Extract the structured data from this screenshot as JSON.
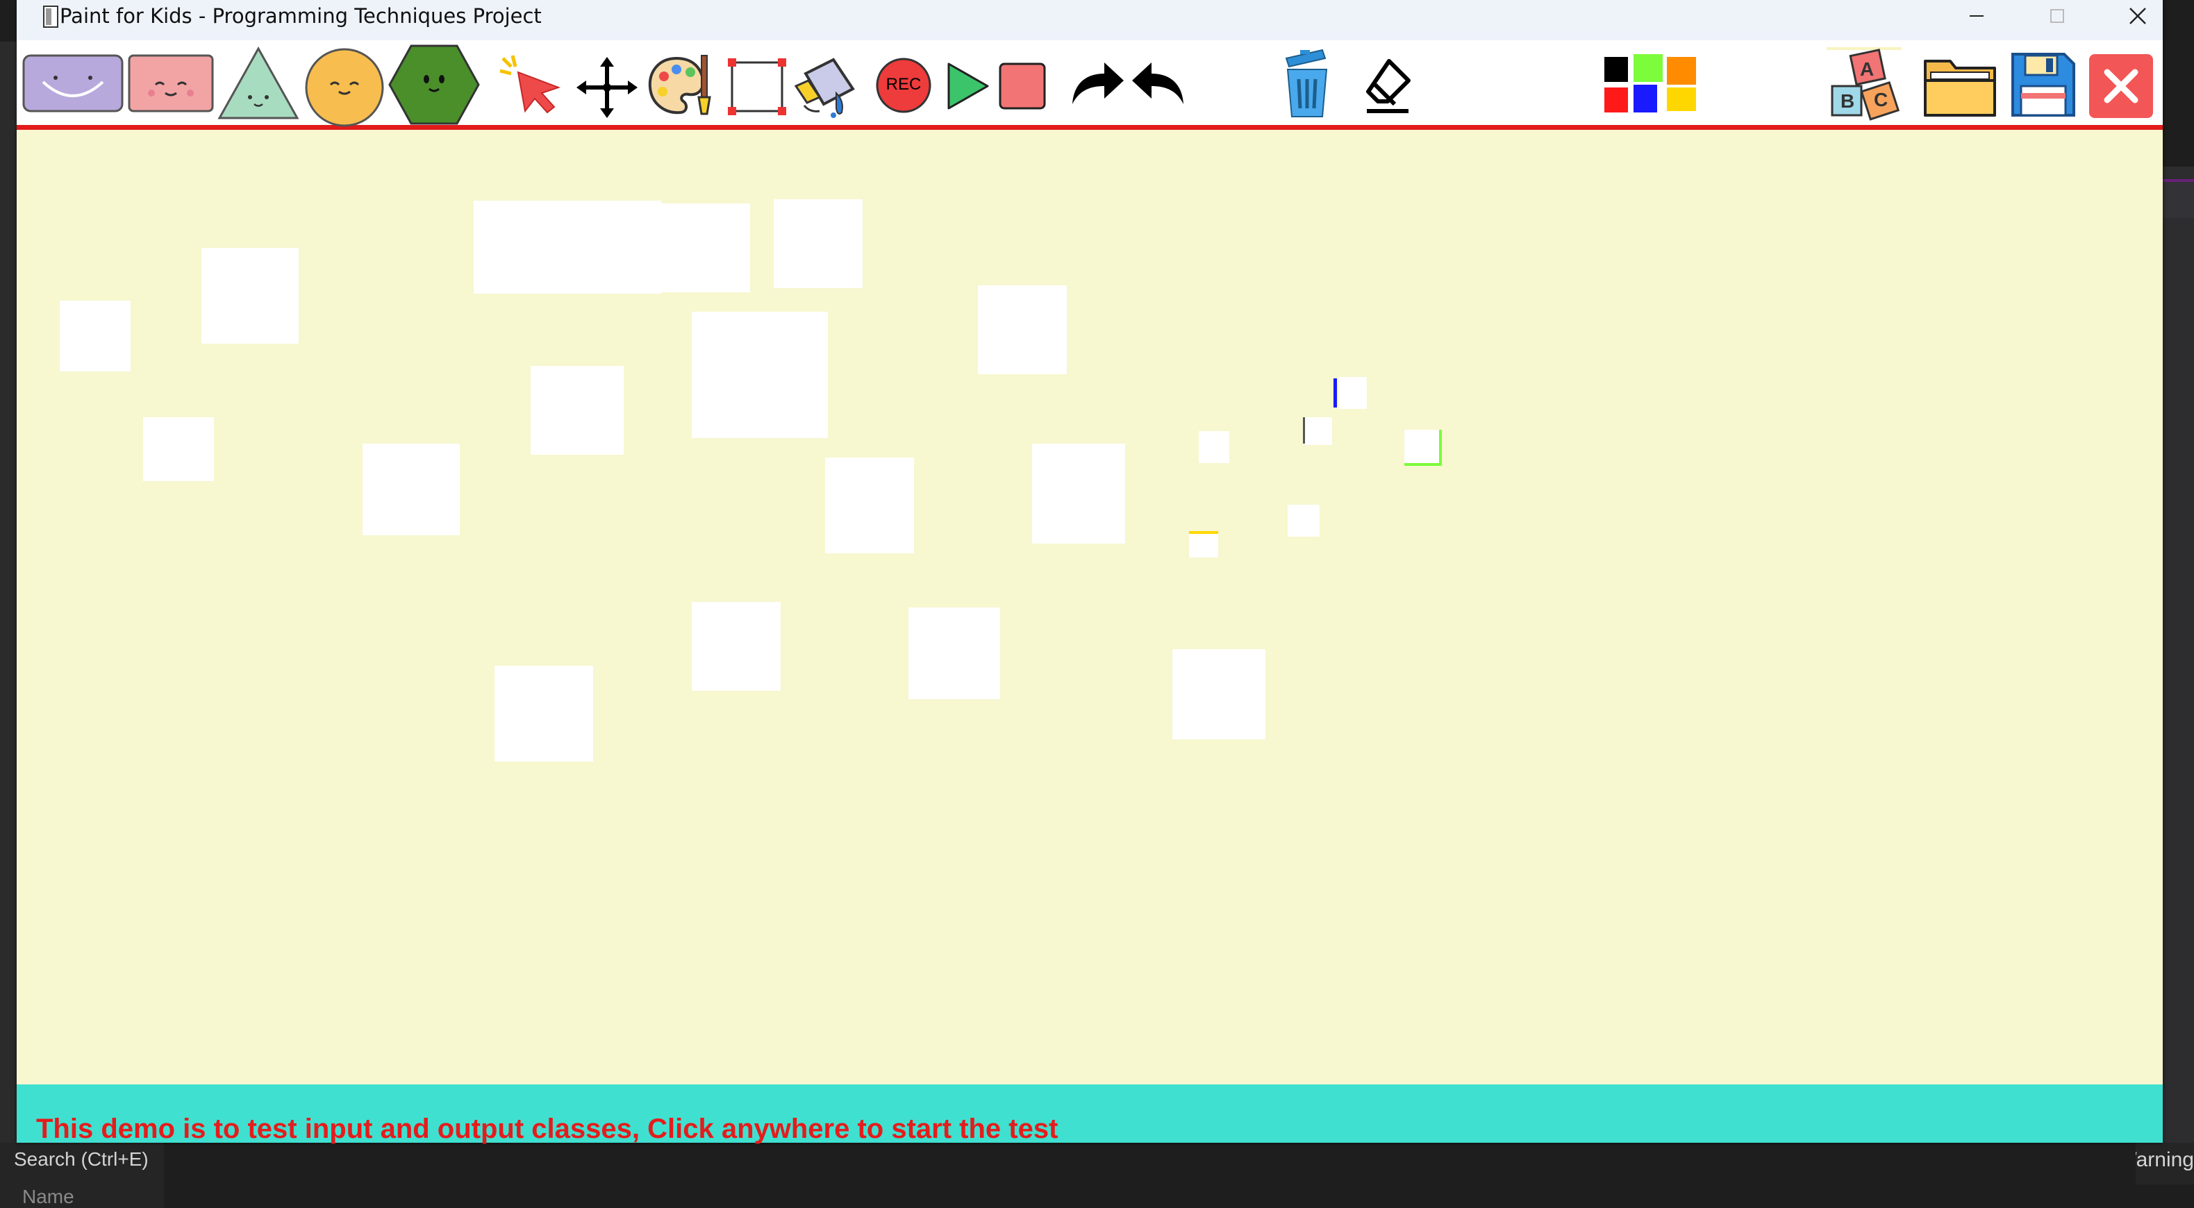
{
  "window": {
    "title": "Paint for Kids - Programming Techniques Project",
    "title_icon": "app-window-icon",
    "controls": [
      "minimize-icon",
      "maximize-icon",
      "close-icon"
    ]
  },
  "toolbar": {
    "shape_tools": [
      {
        "name": "oval-shape-tool",
        "icon": "purple-smiling-oval"
      },
      {
        "name": "rectangle-shape-tool",
        "icon": "pink-smiling-rectangle"
      },
      {
        "name": "triangle-shape-tool",
        "icon": "green-smiling-triangle"
      },
      {
        "name": "circle-shape-tool",
        "icon": "orange-smiling-circle"
      },
      {
        "name": "hexagon-shape-tool",
        "icon": "green-smiling-hexagon"
      }
    ],
    "action_tools": [
      {
        "name": "select-tool",
        "icon": "pointer-icon"
      },
      {
        "name": "move-tool",
        "icon": "move-arrows-icon"
      },
      {
        "name": "color-palette-tool",
        "icon": "palette-icon"
      },
      {
        "name": "resize-tool",
        "icon": "resize-frame-icon"
      },
      {
        "name": "fill-tool",
        "icon": "paint-bucket-icon"
      }
    ],
    "record_label": "REC",
    "record_tools": [
      {
        "name": "record-button",
        "icon": "rec-icon"
      },
      {
        "name": "play-button",
        "icon": "play-icon"
      },
      {
        "name": "stop-button",
        "icon": "stop-icon"
      }
    ],
    "history_tools": [
      {
        "name": "redo-button",
        "icon": "redo-arrow-icon"
      },
      {
        "name": "undo-button",
        "icon": "undo-arrow-icon"
      }
    ],
    "edit_tools": [
      {
        "name": "delete-button",
        "icon": "trash-icon"
      },
      {
        "name": "eraser-button",
        "icon": "eraser-icon"
      }
    ],
    "color_swatches": [
      "#000000",
      "#7cfc3a",
      "#ff8c00",
      "#ff1a1a",
      "#1a1aff",
      "#ffd700"
    ],
    "right_tools": [
      {
        "name": "play-mode-button",
        "icon": "abc-blocks-icon"
      },
      {
        "name": "open-button",
        "icon": "folder-icon"
      },
      {
        "name": "save-button",
        "icon": "floppy-disk-icon"
      },
      {
        "name": "exit-button",
        "icon": "close-x-icon"
      }
    ],
    "abc_letters": [
      "A",
      "B",
      "C"
    ],
    "accent_color": "#e21b1b"
  },
  "canvas": {
    "background": "#f7f7d0"
  },
  "status_bar": {
    "message": "This demo is to test input and output classes, Click anywhere to start the test",
    "background": "#40e0d0",
    "text_color": "#e41c1c"
  },
  "background_app": {
    "search_label": "Search (Ctrl+E)",
    "name_column": "Name",
    "warning_text": "Warning"
  }
}
